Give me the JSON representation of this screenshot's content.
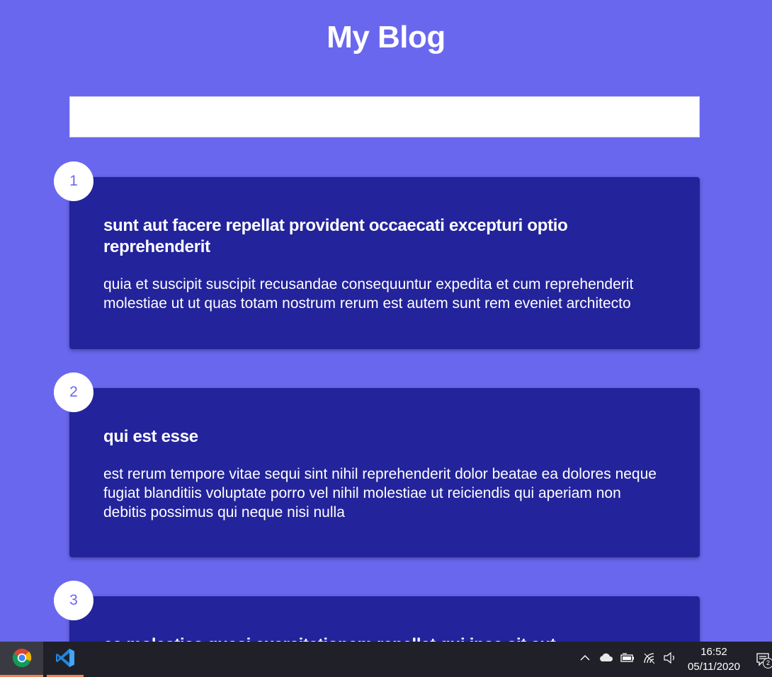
{
  "page": {
    "title": "My Blog"
  },
  "filter": {
    "value": "",
    "placeholder": ""
  },
  "posts": [
    {
      "number": "1",
      "title": "sunt aut facere repellat provident occaecati excepturi optio reprehenderit",
      "body": "quia et suscipit suscipit recusandae consequuntur expedita et cum reprehenderit molestiae ut ut quas totam nostrum rerum est autem sunt rem eveniet architecto"
    },
    {
      "number": "2",
      "title": "qui est esse",
      "body": "est rerum tempore vitae sequi sint nihil reprehenderit dolor beatae ea dolores neque fugiat blanditiis voluptate porro vel nihil molestiae ut reiciendis qui aperiam non debitis possimus qui neque nisi nulla"
    },
    {
      "number": "3",
      "title": "ea molestias quasi exercitationem repellat qui ipsa sit aut",
      "body": ""
    }
  ],
  "taskbar": {
    "apps": [
      {
        "icon": "chrome-icon",
        "active": true
      },
      {
        "icon": "vscode-icon",
        "active": true
      }
    ],
    "tray_icons": [
      "chevron-up-icon",
      "onedrive-cloud-icon",
      "battery-icon",
      "wifi-icon",
      "volume-icon",
      "notification-icon"
    ],
    "time": "16:52",
    "date": "05/11/2020",
    "notification_count": "2"
  },
  "colors": {
    "background": "#6a67ef",
    "card": "#23239b",
    "badge_text": "#6a67ef",
    "taskbar": "#202128",
    "taskbar_accent": "#f0825a"
  }
}
